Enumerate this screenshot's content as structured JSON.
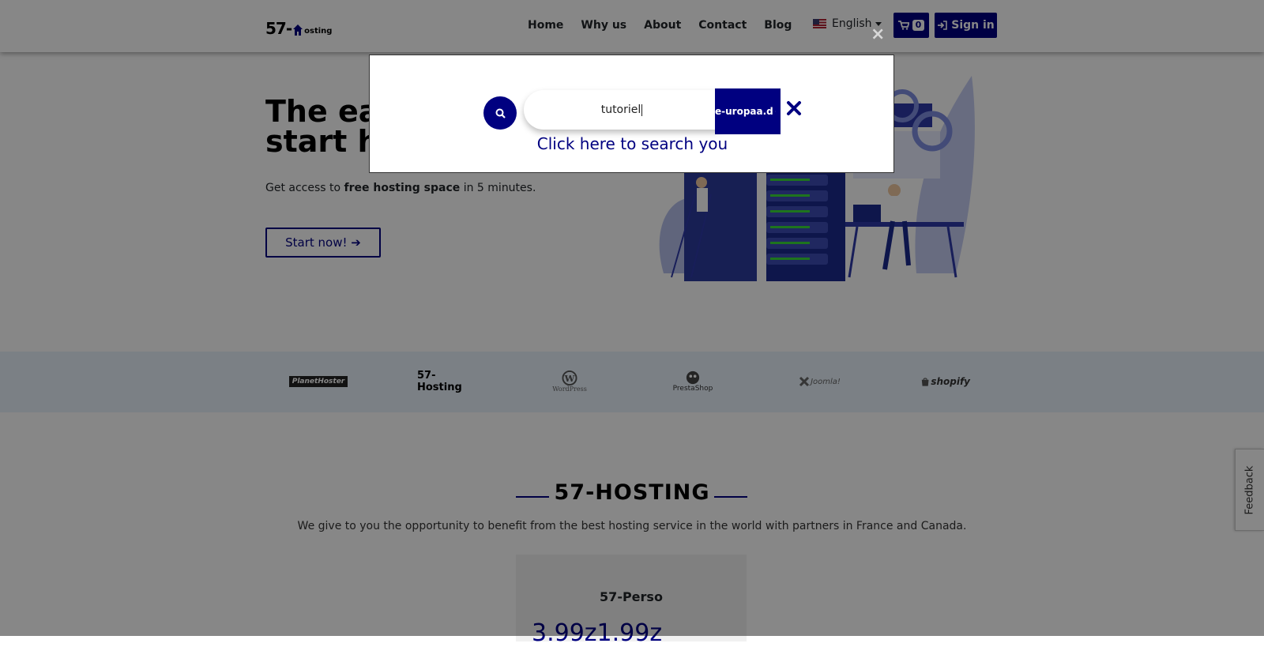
{
  "navbar": {
    "logo_big": "57-",
    "logo_small": "osting",
    "links": [
      "Home",
      "Why us",
      "About",
      "Contact",
      "Blog"
    ],
    "language": "English",
    "cart_count": "0",
    "signin_label": "Sign in"
  },
  "hero": {
    "title": "The ea\nstart h",
    "subtitle_pre": "Get access to ",
    "subtitle_bold": "free hosting space",
    "subtitle_post": " in 5 minutes.",
    "cta_label": "Start now!"
  },
  "partners": [
    "PlanetHoster",
    "57-Hosting",
    "WordPress",
    "PrestaShop",
    "Joomla!",
    "shopify"
  ],
  "section": {
    "title": "57-HOSTING",
    "text": "We give to you the opportunity to benefit from the best hosting service in the world with partners in France and Canada.",
    "plan_name": "57-Perso",
    "plan_price": "3.99z1.99z"
  },
  "feedback_label": "Feedback",
  "search_modal": {
    "close_glyph": "×",
    "query": "tutoriel",
    "domain": "e-uropaa.d",
    "hint": "Click here to search you"
  },
  "colors": {
    "accent": "#000080",
    "overlay": "rgba(0,0,0,0.47)",
    "strip": "#e9f2fb"
  }
}
